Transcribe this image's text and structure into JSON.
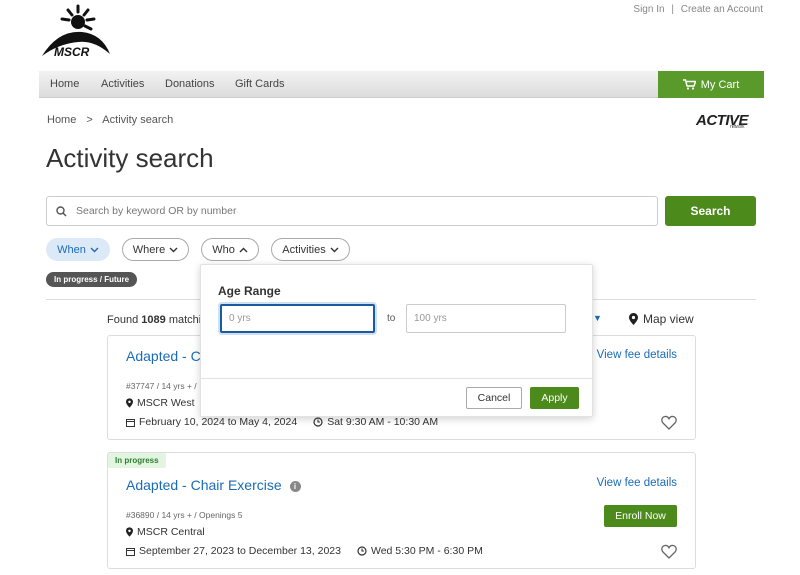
{
  "header": {
    "sign_in": "Sign In",
    "separator": "|",
    "create_account": "Create an Account",
    "logo_text": "MSCR"
  },
  "nav": {
    "items": [
      "Home",
      "Activities",
      "Donations",
      "Gift Cards"
    ],
    "cart_label": "My Cart"
  },
  "breadcrumb": {
    "home": "Home",
    "sep": ">",
    "current": "Activity search"
  },
  "active_logo": {
    "text": "ACTIVE",
    "sub": "network"
  },
  "page_title": "Activity search",
  "search": {
    "placeholder": "Search by keyword OR by number",
    "button": "Search"
  },
  "filters": {
    "when": "When",
    "where": "Where",
    "who": "Who",
    "activities": "Activities",
    "status_tag": "In progress / Future"
  },
  "results": {
    "found_prefix": "Found",
    "count": "1089",
    "found_suffix": "matchin",
    "map_view": "Map view"
  },
  "cards": [
    {
      "title": "Adapted - C",
      "fee": "View fee details",
      "meta": "#37747 / 14 yrs + /",
      "location": "MSCR West",
      "dates": "February 10, 2024 to May 4, 2024",
      "time": "Sat 9:30 AM - 10:30 AM"
    },
    {
      "badge": "In progress",
      "title": "Adapted - Chair Exercise",
      "fee": "View fee details",
      "meta": "#36890 / 14 yrs + / Openings 5",
      "location": "MSCR Central",
      "dates": "September 27, 2023 to December 13, 2023",
      "time": "Wed 5:30 PM - 6:30 PM",
      "enroll": "Enroll Now"
    }
  ],
  "popover": {
    "title": "Age Range",
    "min_placeholder": "0 yrs",
    "to": "to",
    "max_placeholder": "100 yrs",
    "cancel": "Cancel",
    "apply": "Apply"
  },
  "colors": {
    "green": "#4c8a1c",
    "blue": "#1a6bb8",
    "cart": "#5a9a2a"
  }
}
